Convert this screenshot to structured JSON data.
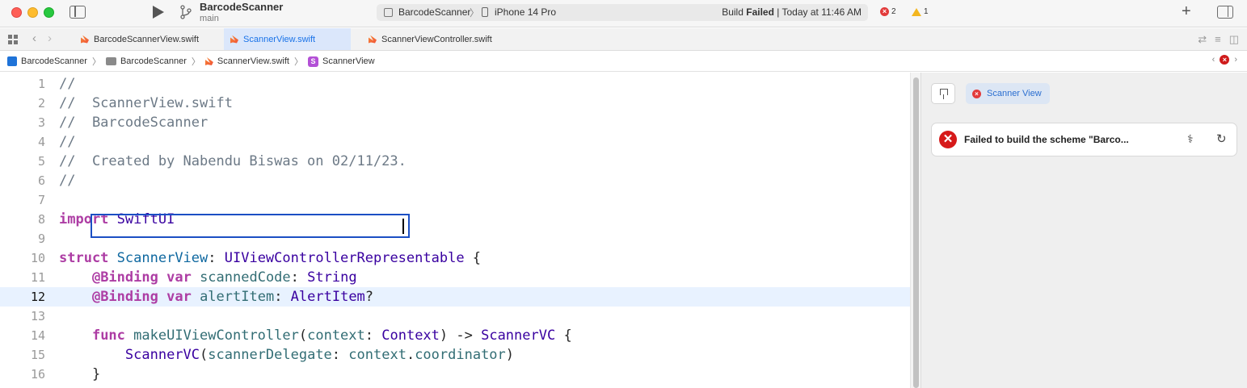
{
  "toolbar": {
    "project_name": "BarcodeScanner",
    "branch": "main",
    "scheme": "BarcodeScanner",
    "scheme_separator": "〉",
    "device": "iPhone 14 Pro",
    "build_prefix": "Build ",
    "build_result": "Failed",
    "build_time": " | Today at 11:46 AM",
    "error_count": "2",
    "warning_count": "1"
  },
  "tabs": [
    {
      "label": "BarcodeScannerView.swift",
      "active": false
    },
    {
      "label": "ScannerView.swift",
      "active": true
    },
    {
      "label": "ScannerViewController.swift",
      "active": false
    }
  ],
  "breadcrumb": {
    "project": "BarcodeScanner",
    "group": "BarcodeScanner",
    "file": "ScannerView.swift",
    "symbol_badge": "S",
    "symbol": "ScannerView",
    "separator": "〉"
  },
  "editor": {
    "current_line": 12,
    "lines": [
      {
        "n": "1",
        "text": "//"
      },
      {
        "n": "2",
        "text": "//  ScannerView.swift"
      },
      {
        "n": "3",
        "text": "//  BarcodeScanner"
      },
      {
        "n": "4",
        "text": "//"
      },
      {
        "n": "5",
        "text": "//  Created by Nabendu Biswas on 02/11/23."
      },
      {
        "n": "6",
        "text": "//"
      },
      {
        "n": "7",
        "text": ""
      },
      {
        "n": "8",
        "text": "import SwiftUI"
      },
      {
        "n": "9",
        "text": ""
      },
      {
        "n": "10",
        "text": "struct ScannerView: UIViewControllerRepresentable {"
      },
      {
        "n": "11",
        "text": "    @Binding var scannedCode: String"
      },
      {
        "n": "12",
        "text": "    @Binding var alertItem: AlertItem?"
      },
      {
        "n": "13",
        "text": ""
      },
      {
        "n": "14",
        "text": "    func makeUIViewController(context: Context) -> ScannerVC {"
      },
      {
        "n": "15",
        "text": "        ScannerVC(scannerDelegate: context.coordinator)"
      },
      {
        "n": "16",
        "text": "    }"
      }
    ]
  },
  "canvas": {
    "preview_label": "Scanner View",
    "error_message": "Failed to build the scheme \"Barco...",
    "error_glyph": "✕"
  },
  "colors": {
    "accent": "#1a73e8",
    "error": "#d61a1a",
    "warning": "#f3b61f",
    "keyword": "#ad3da4",
    "comment": "#6c7986"
  }
}
